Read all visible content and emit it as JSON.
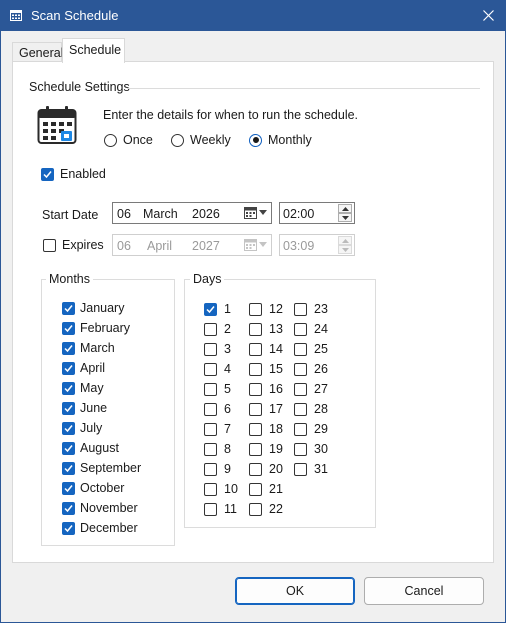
{
  "window": {
    "title": "Scan Schedule"
  },
  "tabs": [
    {
      "label": "General"
    },
    {
      "label": "Schedule"
    }
  ],
  "schedule_settings": {
    "title": "Schedule Settings",
    "intro": "Enter the details for when to run the schedule.",
    "frequency": [
      {
        "label": "Once",
        "selected": false
      },
      {
        "label": "Weekly",
        "selected": false
      },
      {
        "label": "Monthly",
        "selected": true
      }
    ]
  },
  "enabled": {
    "label": "Enabled",
    "checked": true
  },
  "start_date": {
    "label": "Start Date",
    "day": "06",
    "month": "March",
    "year": "2026",
    "time": "02:00"
  },
  "expires": {
    "label": "Expires",
    "checked": false,
    "day": "06",
    "month": "April",
    "year": "2027",
    "time": "03:09"
  },
  "months": {
    "title": "Months",
    "items": [
      {
        "label": "January",
        "checked": true
      },
      {
        "label": "February",
        "checked": true
      },
      {
        "label": "March",
        "checked": true
      },
      {
        "label": "April",
        "checked": true
      },
      {
        "label": "May",
        "checked": true
      },
      {
        "label": "June",
        "checked": true
      },
      {
        "label": "July",
        "checked": true
      },
      {
        "label": "August",
        "checked": true
      },
      {
        "label": "September",
        "checked": true
      },
      {
        "label": "October",
        "checked": true
      },
      {
        "label": "November",
        "checked": true
      },
      {
        "label": "December",
        "checked": true
      }
    ]
  },
  "days": {
    "title": "Days",
    "items": [
      {
        "label": "1",
        "checked": true
      },
      {
        "label": "2",
        "checked": false
      },
      {
        "label": "3",
        "checked": false
      },
      {
        "label": "4",
        "checked": false
      },
      {
        "label": "5",
        "checked": false
      },
      {
        "label": "6",
        "checked": false
      },
      {
        "label": "7",
        "checked": false
      },
      {
        "label": "8",
        "checked": false
      },
      {
        "label": "9",
        "checked": false
      },
      {
        "label": "10",
        "checked": false
      },
      {
        "label": "11",
        "checked": false
      },
      {
        "label": "12",
        "checked": false
      },
      {
        "label": "13",
        "checked": false
      },
      {
        "label": "14",
        "checked": false
      },
      {
        "label": "15",
        "checked": false
      },
      {
        "label": "16",
        "checked": false
      },
      {
        "label": "17",
        "checked": false
      },
      {
        "label": "18",
        "checked": false
      },
      {
        "label": "19",
        "checked": false
      },
      {
        "label": "20",
        "checked": false
      },
      {
        "label": "21",
        "checked": false
      },
      {
        "label": "22",
        "checked": false
      },
      {
        "label": "23",
        "checked": false
      },
      {
        "label": "24",
        "checked": false
      },
      {
        "label": "25",
        "checked": false
      },
      {
        "label": "26",
        "checked": false
      },
      {
        "label": "27",
        "checked": false
      },
      {
        "label": "28",
        "checked": false
      },
      {
        "label": "29",
        "checked": false
      },
      {
        "label": "30",
        "checked": false
      },
      {
        "label": "31",
        "checked": false
      }
    ]
  },
  "buttons": {
    "ok": "OK",
    "cancel": "Cancel"
  },
  "colors": {
    "titlebar": "#2b5797",
    "accent": "#1565c0"
  },
  "icons": {
    "app": "calendar-icon",
    "close": "close-icon",
    "schedule": "calendar-grid-icon"
  }
}
